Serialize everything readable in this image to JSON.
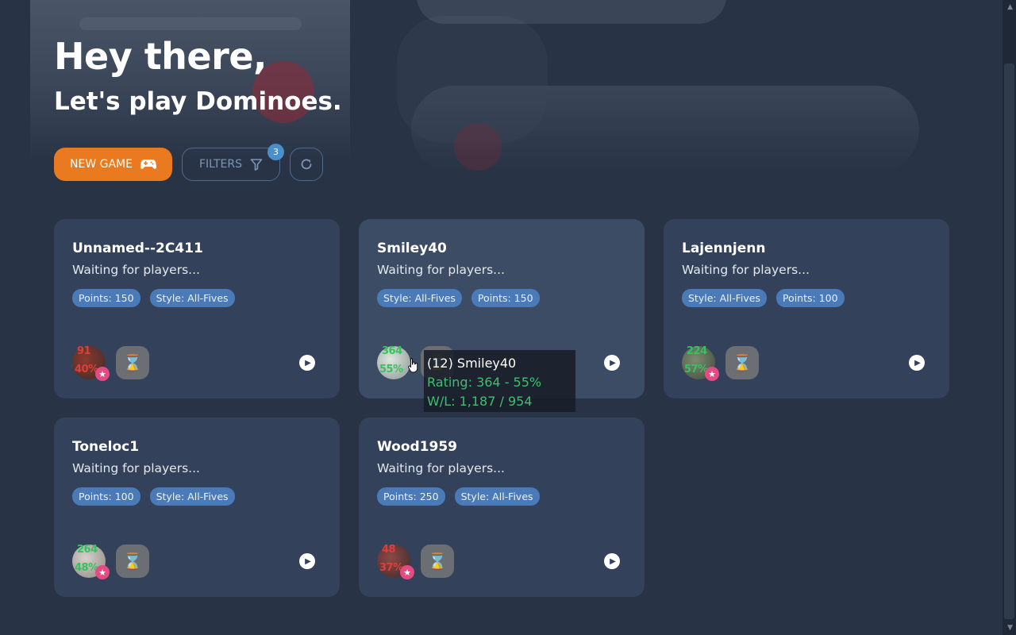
{
  "hero": {
    "title": "Hey there,",
    "subtitle": "Let's play Dominoes."
  },
  "toolbar": {
    "new_game_label": "NEW GAME",
    "filters_label": "FILTERS",
    "filters_count": "3"
  },
  "games": [
    {
      "name": "Unnamed--2C411",
      "status": "Waiting for players...",
      "tags": [
        "Points: 150",
        "Style: All-Fives"
      ],
      "rating": "91",
      "win_pct": "40%",
      "rating_color": "#e03d3d"
    },
    {
      "name": "Smiley40",
      "status": "Waiting for players...",
      "tags": [
        "Style: All-Fives",
        "Points: 150"
      ],
      "rating": "364",
      "win_pct": "55%",
      "rating_color": "#36c25f"
    },
    {
      "name": "Lajennjenn",
      "status": "Waiting for players...",
      "tags": [
        "Style: All-Fives",
        "Points: 100"
      ],
      "rating": "224",
      "win_pct": "57%",
      "rating_color": "#36c25f"
    },
    {
      "name": "Toneloc1",
      "status": "Waiting for players...",
      "tags": [
        "Points: 100",
        "Style: All-Fives"
      ],
      "rating": "264",
      "win_pct": "48%",
      "rating_color": "#36c25f"
    },
    {
      "name": "Wood1959",
      "status": "Waiting for players...",
      "tags": [
        "Points: 250",
        "Style: All-Fives"
      ],
      "rating": "48",
      "win_pct": "37%",
      "rating_color": "#e03d3d"
    }
  ],
  "tooltip": {
    "line1": "(12) Smiley40",
    "line2": "Rating: 364 - 55%",
    "line3": "W/L: 1,187 / 954"
  }
}
